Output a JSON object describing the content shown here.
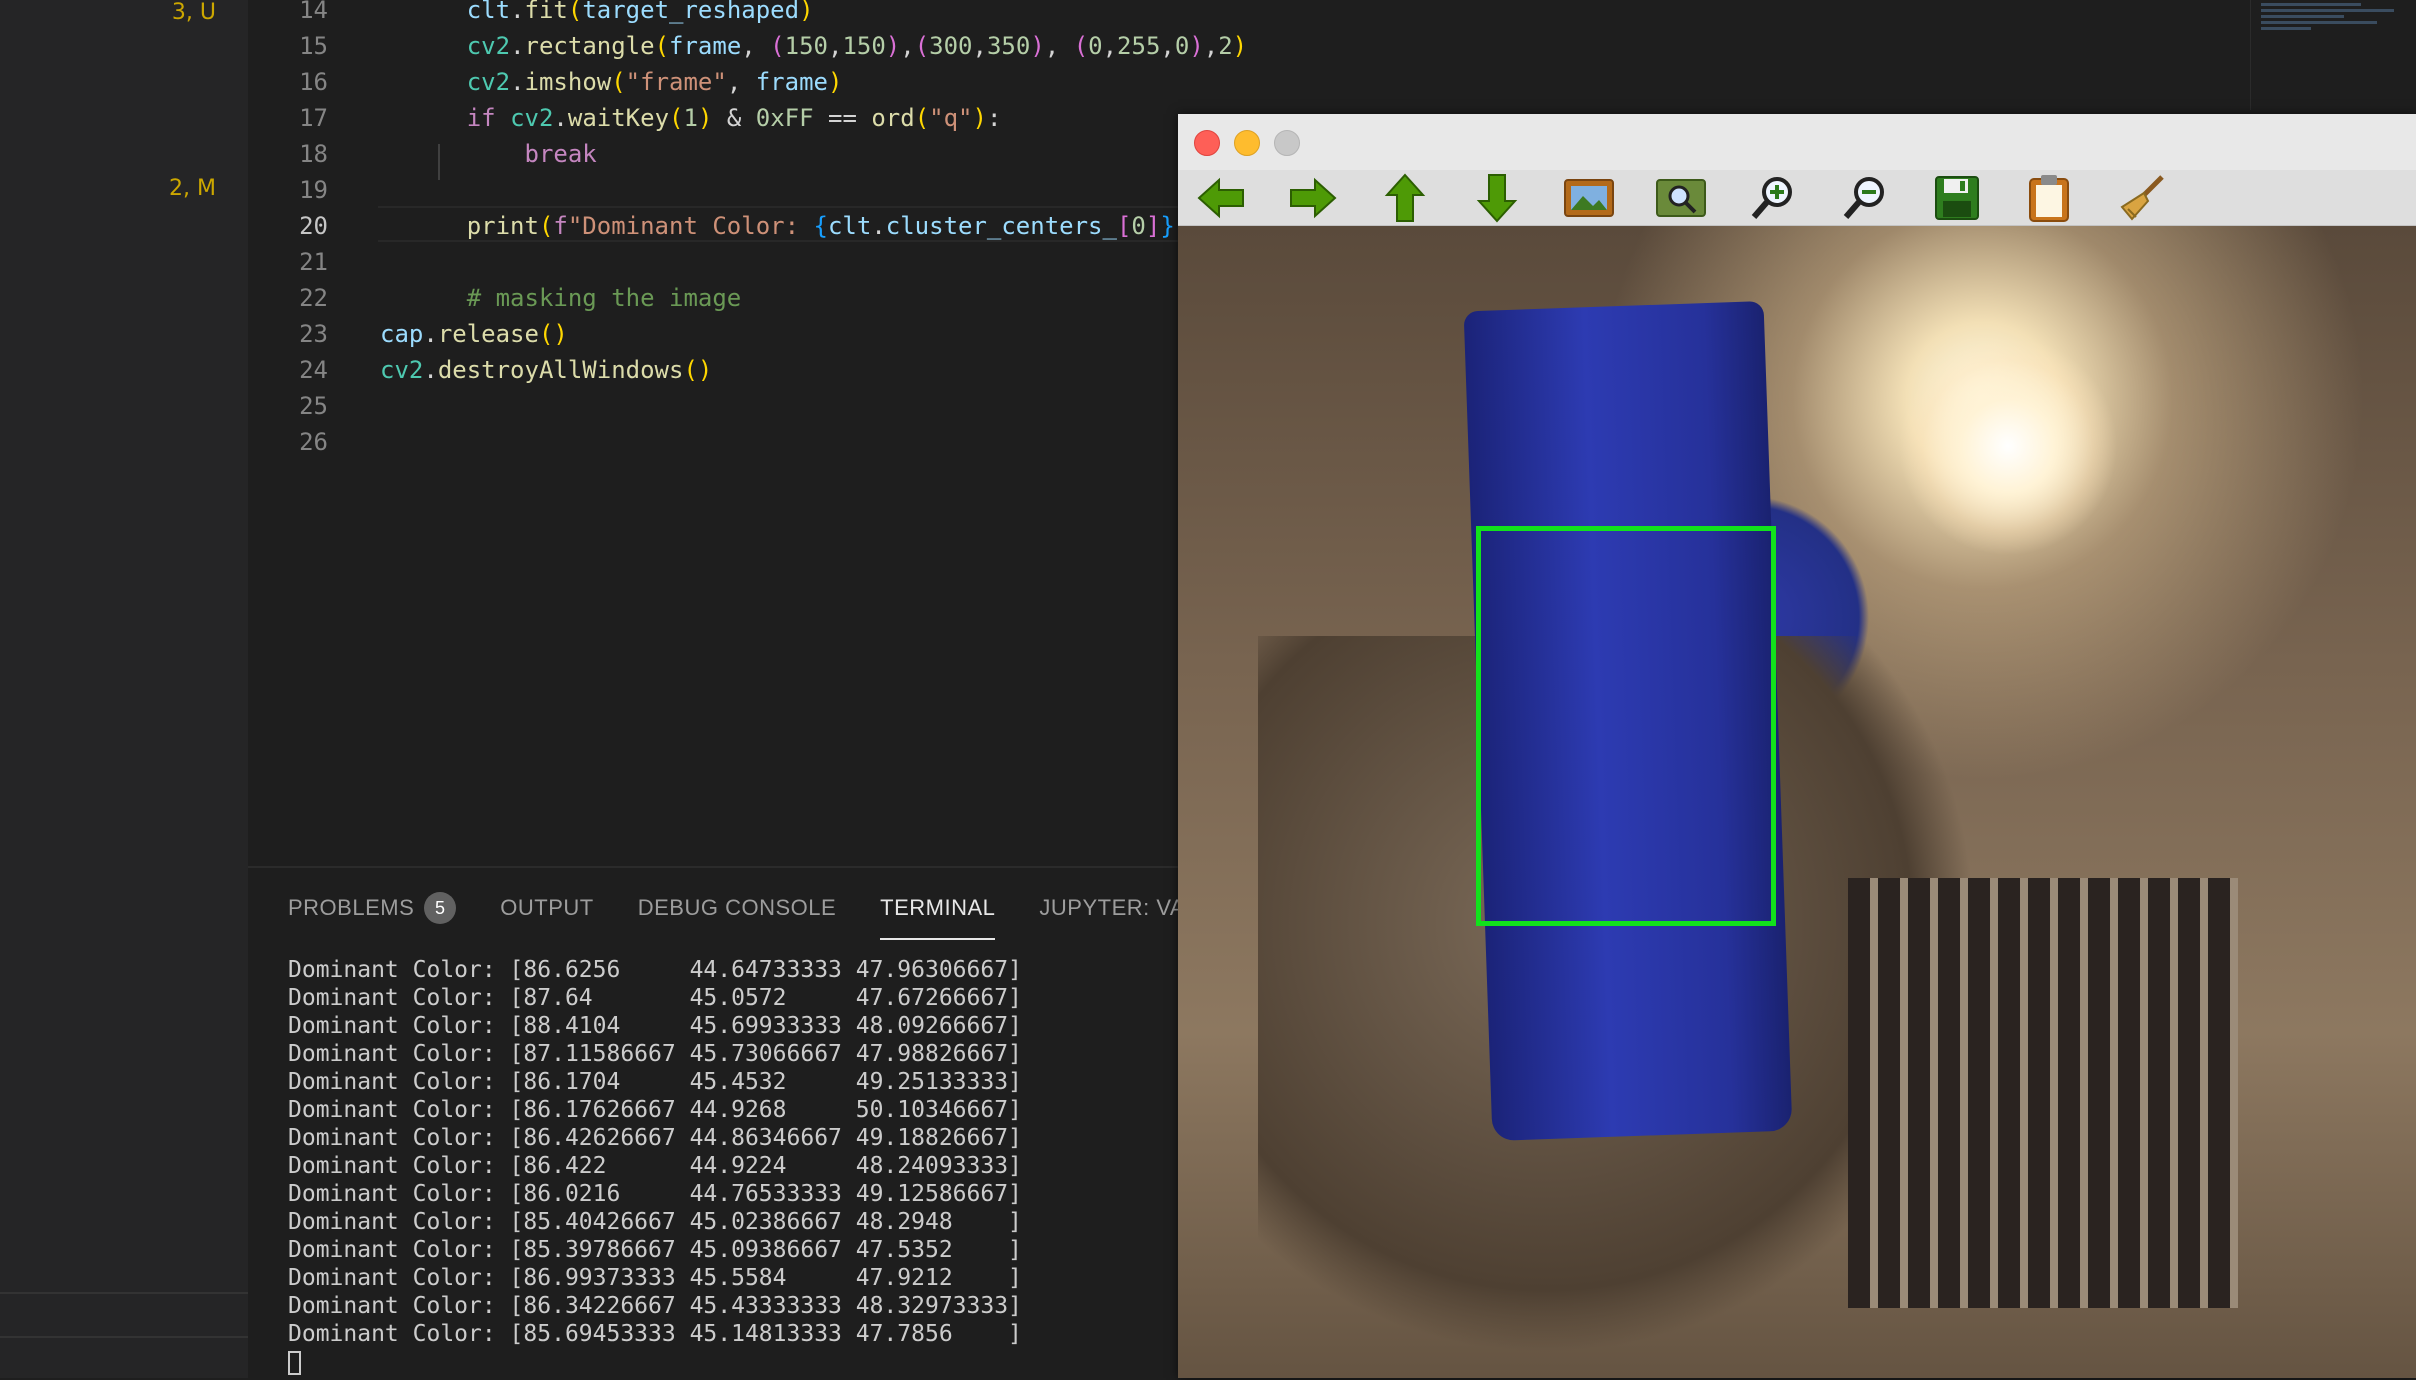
{
  "sidebar": {
    "badges": [
      "3, U",
      "2, M"
    ]
  },
  "editor": {
    "active_line": "20",
    "lines": [
      {
        "num": "14",
        "tokens": [
          [
            "      ",
            "w"
          ],
          [
            "clt",
            "var"
          ],
          [
            ".",
            "w"
          ],
          [
            "fit",
            "fn"
          ],
          [
            "(",
            "p1"
          ],
          [
            "target_reshaped",
            "var"
          ],
          [
            ")",
            "p1"
          ]
        ]
      },
      {
        "num": "15",
        "tokens": [
          [
            "      ",
            "w"
          ],
          [
            "cv2",
            "type"
          ],
          [
            ".",
            "w"
          ],
          [
            "rectangle",
            "fn"
          ],
          [
            "(",
            "p1"
          ],
          [
            "frame",
            "var"
          ],
          [
            ", ",
            "w"
          ],
          [
            "(",
            "p2"
          ],
          [
            "150",
            "num"
          ],
          [
            ",",
            "w"
          ],
          [
            "150",
            "num"
          ],
          [
            ")",
            "p2"
          ],
          [
            ",",
            "w"
          ],
          [
            "(",
            "p2"
          ],
          [
            "300",
            "num"
          ],
          [
            ",",
            "w"
          ],
          [
            "350",
            "num"
          ],
          [
            ")",
            "p2"
          ],
          [
            ", ",
            "w"
          ],
          [
            "(",
            "p2"
          ],
          [
            "0",
            "num"
          ],
          [
            ",",
            "w"
          ],
          [
            "255",
            "num"
          ],
          [
            ",",
            "w"
          ],
          [
            "0",
            "num"
          ],
          [
            ")",
            "p2"
          ],
          [
            ",",
            "w"
          ],
          [
            "2",
            "num"
          ],
          [
            ")",
            "p1"
          ]
        ]
      },
      {
        "num": "16",
        "tokens": [
          [
            "      ",
            "w"
          ],
          [
            "cv2",
            "type"
          ],
          [
            ".",
            "w"
          ],
          [
            "imshow",
            "fn"
          ],
          [
            "(",
            "p1"
          ],
          [
            "\"frame\"",
            "str"
          ],
          [
            ", ",
            "w"
          ],
          [
            "frame",
            "var"
          ],
          [
            ")",
            "p1"
          ]
        ]
      },
      {
        "num": "17",
        "tokens": [
          [
            "      ",
            "w"
          ],
          [
            "if ",
            "kw"
          ],
          [
            "cv2",
            "type"
          ],
          [
            ".",
            "w"
          ],
          [
            "waitKey",
            "fn"
          ],
          [
            "(",
            "p1"
          ],
          [
            "1",
            "num"
          ],
          [
            ")",
            "p1"
          ],
          [
            " & ",
            "w"
          ],
          [
            "0xFF",
            "num"
          ],
          [
            " == ",
            "w"
          ],
          [
            "ord",
            "fn"
          ],
          [
            "(",
            "p1"
          ],
          [
            "\"q\"",
            "str"
          ],
          [
            ")",
            "p1"
          ],
          [
            ":",
            "w"
          ]
        ]
      },
      {
        "num": "18",
        "tokens": [
          [
            "          ",
            "w"
          ],
          [
            "break",
            "kw"
          ]
        ]
      },
      {
        "num": "19",
        "tokens": []
      },
      {
        "num": "20",
        "tokens": [
          [
            "      ",
            "w"
          ],
          [
            "print",
            "fn"
          ],
          [
            "(",
            "p1"
          ],
          [
            "f",
            "kw"
          ],
          [
            "\"Dominant Color: ",
            "str"
          ],
          [
            "{",
            "p3"
          ],
          [
            "clt",
            "var"
          ],
          [
            ".",
            "w"
          ],
          [
            "cluster_centers_",
            "var"
          ],
          [
            "[",
            "p2"
          ],
          [
            "0",
            "num"
          ],
          [
            "]",
            "p2"
          ],
          [
            "}",
            "p3"
          ],
          [
            "\"",
            "str"
          ],
          [
            ")",
            "p1"
          ]
        ]
      },
      {
        "num": "21",
        "tokens": []
      },
      {
        "num": "22",
        "tokens": [
          [
            "      ",
            "w"
          ],
          [
            "# masking the image",
            "cm"
          ]
        ]
      },
      {
        "num": "23",
        "tokens": [
          [
            "cap",
            "var"
          ],
          [
            ".",
            "w"
          ],
          [
            "release",
            "fn"
          ],
          [
            "()",
            "p1"
          ]
        ]
      },
      {
        "num": "24",
        "tokens": [
          [
            "cv2",
            "type"
          ],
          [
            ".",
            "w"
          ],
          [
            "destroyAllWindows",
            "fn"
          ],
          [
            "()",
            "p1"
          ]
        ]
      },
      {
        "num": "25",
        "tokens": []
      },
      {
        "num": "26",
        "tokens": []
      }
    ]
  },
  "panel": {
    "tabs": [
      {
        "label": "PROBLEMS",
        "badge": "5"
      },
      {
        "label": "OUTPUT"
      },
      {
        "label": "DEBUG CONSOLE"
      },
      {
        "label": "TERMINAL",
        "active": true
      },
      {
        "label": "JUPYTER: VA"
      }
    ],
    "terminal_lines": [
      "Dominant Color: [86.6256     44.64733333 47.96306667]",
      "Dominant Color: [87.64       45.0572     47.67266667]",
      "Dominant Color: [88.4104     45.69933333 48.09266667]",
      "Dominant Color: [87.11586667 45.73066667 47.98826667]",
      "Dominant Color: [86.1704     45.4532     49.25133333]",
      "Dominant Color: [86.17626667 44.9268     50.10346667]",
      "Dominant Color: [86.42626667 44.86346667 49.18826667]",
      "Dominant Color: [86.422      44.9224     48.24093333]",
      "Dominant Color: [86.0216     44.76533333 49.12586667]",
      "Dominant Color: [85.40426667 45.02386667 48.2948    ]",
      "Dominant Color: [85.39786667 45.09386667 47.5352    ]",
      "Dominant Color: [86.99373333 45.5584     47.9212    ]",
      "Dominant Color: [86.34226667 45.43333333 48.32973333]",
      "Dominant Color: [85.69453333 45.14813333 47.7856    ]"
    ]
  },
  "cv_window": {
    "toolbar_icons": [
      "arrow-left-icon",
      "arrow-right-icon",
      "arrow-up-icon",
      "arrow-down-icon",
      "image-icon",
      "zoom-fit-icon",
      "zoom-in-icon",
      "zoom-out-icon",
      "save-icon",
      "clipboard-icon",
      "broom-icon"
    ],
    "box_color": "#12e21c"
  }
}
